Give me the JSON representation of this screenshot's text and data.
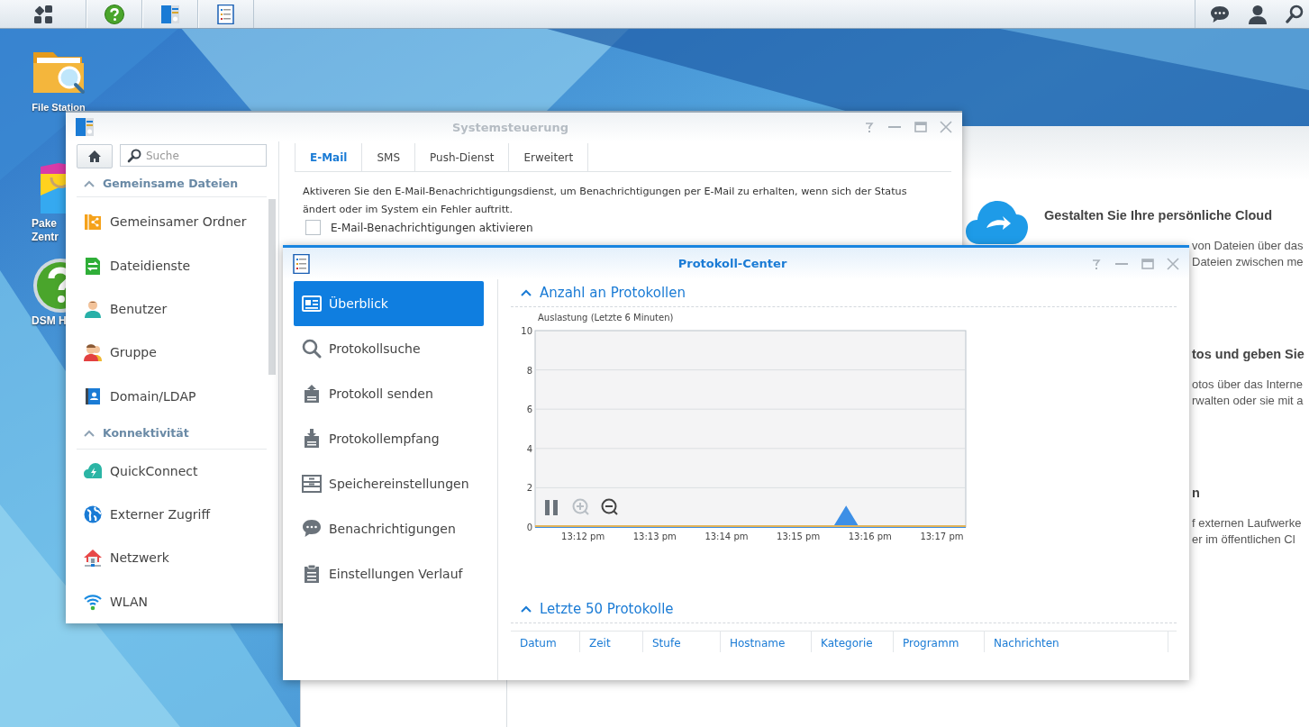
{
  "desktop_icons": [
    {
      "lines": [
        "File Station"
      ]
    },
    {
      "lines": [
        "Pake",
        "Zentr"
      ]
    },
    {
      "lines": [
        "DSM H"
      ]
    }
  ],
  "background_window": {
    "sections": [
      {
        "title": "Gestalten Sie Ihre persönliche Cloud",
        "lines": [
          "von Dateien über das",
          "Dateien zwischen me"
        ]
      },
      {
        "title": "tos und geben Sie",
        "lines": [
          "otos über das Interne",
          "rwalten oder sie mit a"
        ]
      },
      {
        "title": "n",
        "lines": [
          "f externen Laufwerke",
          "er im öffentlichen Cl"
        ]
      }
    ]
  },
  "control_panel": {
    "title": "Systemsteuerung",
    "active": false,
    "search": {
      "placeholder": "Suche"
    },
    "sections": [
      {
        "title": "Gemeinsame Dateien",
        "expanded": true,
        "items": [
          {
            "label": "Gemeinsamer Ordner"
          },
          {
            "label": "Dateidienste"
          },
          {
            "label": "Benutzer"
          },
          {
            "label": "Gruppe"
          },
          {
            "label": "Domain/LDAP"
          }
        ]
      },
      {
        "title": "Konnektivität",
        "expanded": true,
        "items": [
          {
            "label": "QuickConnect"
          },
          {
            "label": "Externer Zugriff"
          },
          {
            "label": "Netzwerk"
          },
          {
            "label": "WLAN"
          }
        ]
      }
    ],
    "tabs": [
      {
        "label": "E-Mail",
        "selected": true
      },
      {
        "label": "SMS",
        "selected": false
      },
      {
        "label": "Push-Dienst",
        "selected": false
      },
      {
        "label": "Erweitert",
        "selected": false
      }
    ],
    "description": "Aktiveren Sie den E-Mail-Benachrichtigungsdienst, um Benachrichtigungen per E-Mail zu erhalten, wenn sich der Status ändert oder im System ein Fehler auftritt.",
    "checkbox": {
      "label": "E-Mail-Benachrichtigungen aktivieren",
      "checked": false
    }
  },
  "log_center": {
    "title": "Protokoll-Center",
    "active": true,
    "nav": [
      {
        "label": "Überblick",
        "selected": true
      },
      {
        "label": "Protokollsuche",
        "selected": false
      },
      {
        "label": "Protokoll senden",
        "selected": false
      },
      {
        "label": "Protokollempfang",
        "selected": false
      },
      {
        "label": "Speichereinstellungen",
        "selected": false
      },
      {
        "label": "Benachrichtigungen",
        "selected": false
      },
      {
        "label": "Einstellungen Verlauf",
        "selected": false
      }
    ],
    "chart_section": {
      "title": "Anzahl an Protokollen",
      "expanded": true,
      "chart_data": {
        "type": "area",
        "title": "Auslastung (Letzte 6 Minuten)",
        "categories": [
          null,
          null,
          null,
          null,
          "13:12 pm",
          null,
          null,
          null,
          null,
          null,
          "13:13 pm",
          null,
          null,
          null,
          null,
          null,
          "13:14 pm",
          null,
          null,
          null,
          null,
          null,
          "13:15 pm",
          null,
          null,
          null,
          null,
          null,
          "13:16 pm",
          null,
          null,
          null,
          null,
          null,
          "13:17 pm",
          null,
          null
        ],
        "series": [
          {
            "color": "#3d8fe6",
            "values": [
              0,
              0,
              0,
              0,
              0,
              0,
              0,
              0,
              0,
              0,
              0,
              0,
              0,
              0,
              0,
              0,
              0,
              0,
              0,
              0,
              0,
              0,
              0,
              0,
              0,
              0,
              1,
              0,
              0,
              0,
              0,
              0,
              0,
              0,
              0,
              0,
              0
            ]
          }
        ],
        "ylim": [
          0,
          10
        ],
        "grid": true,
        "yticks": [
          0,
          2,
          4,
          6,
          8,
          10
        ]
      }
    },
    "table_section": {
      "title": "Letzte 50 Protokolle",
      "expanded": true,
      "columns": [
        "Datum",
        "Zeit",
        "Stufe",
        "Hostname",
        "Kategorie",
        "Programm",
        "Nachrichten"
      ]
    }
  }
}
